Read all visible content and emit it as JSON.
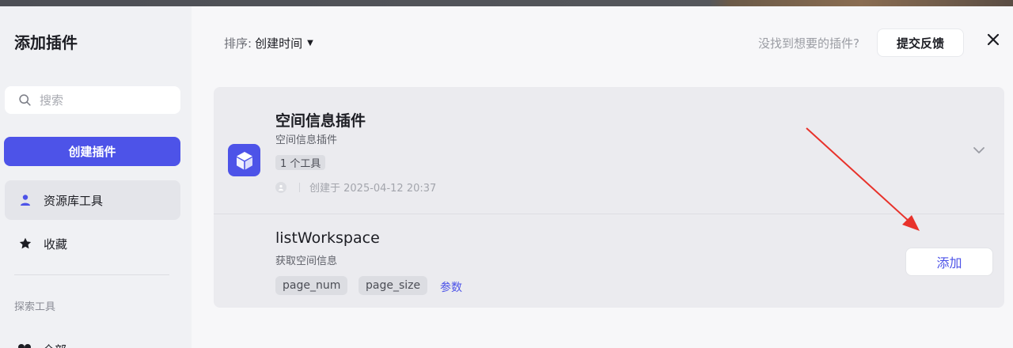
{
  "sidebar": {
    "title": "添加插件",
    "search": {
      "placeholder": "搜索",
      "value": ""
    },
    "create_button": "创建插件",
    "items": [
      {
        "label": "资源库工具",
        "icon": "user-icon",
        "active": true
      },
      {
        "label": "收藏",
        "icon": "star-icon",
        "active": false
      }
    ],
    "section_label": "探索工具",
    "partial_item": {
      "label": "全部",
      "icon": "grid-icon"
    }
  },
  "header": {
    "sort_label": "排序:",
    "sort_value": "创建时间",
    "not_found_text": "没找到想要的插件?",
    "feedback_button": "提交反馈"
  },
  "plugin": {
    "name": "空间信息插件",
    "description": "空间信息插件",
    "tool_count": "1 个工具",
    "created": "创建于 2025-04-12 20:37",
    "icon": "cube-icon",
    "tools": [
      {
        "name": "listWorkspace",
        "description": "获取空间信息",
        "params": [
          "page_num",
          "page_size"
        ],
        "params_link": "参数",
        "add_button": "添加"
      }
    ]
  },
  "colors": {
    "accent": "#4d53e8",
    "annotation_arrow": "#e8322b"
  }
}
